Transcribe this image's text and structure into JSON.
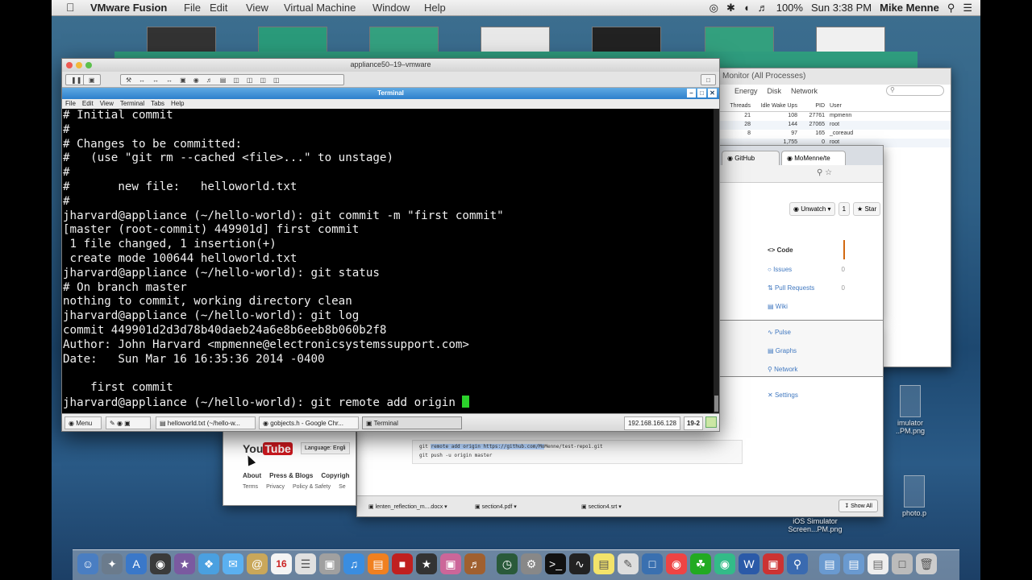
{
  "menubar": {
    "apple_icon": "apple-icon",
    "app_name": "VMware Fusion",
    "items": [
      "File",
      "Edit",
      "View",
      "Virtual Machine",
      "Window",
      "Help"
    ],
    "battery": "100%",
    "clock": "Sun 3:38 PM",
    "user": "Mike Menne"
  },
  "activity_monitor": {
    "title": "Monitor (All Processes)",
    "tabs": [
      "Energy",
      "Disk",
      "Network"
    ],
    "columns": [
      "Threads",
      "Idle Wake Ups",
      "PID",
      "User"
    ],
    "rows": [
      [
        "21",
        "108",
        "27761",
        "mpmenn"
      ],
      [
        "28",
        "144",
        "27065",
        "root"
      ],
      [
        "8",
        "97",
        "165",
        "_coreaud"
      ],
      [
        "",
        "1,755",
        "0",
        "root"
      ]
    ]
  },
  "github_window": {
    "tabs": [
      "GitHub",
      "MoMenne/te"
    ],
    "unwatch_label": "Unwatch",
    "unwatch_count": "1",
    "star_label": "Star",
    "star_count": "0",
    "nav": [
      "Code",
      "Issues",
      "Pull Requests",
      "Wiki",
      "Pulse",
      "Graphs",
      "Network",
      "Settings"
    ],
    "nav_counts": [
      "",
      "0",
      "0",
      "",
      "",
      "",
      "",
      ""
    ],
    "code_line1_prefix": "git ",
    "code_line1_highlight": "remote add origin https://github.com/Mo",
    "code_line1_suffix": "Menne/test-repo1.git",
    "code_line2": "git push -u origin master"
  },
  "downloads": {
    "items": [
      "lenten_reflection_m....docx",
      "section4.pdf",
      "section4.srt"
    ],
    "show_all": "Show All"
  },
  "youtube_window": {
    "logo_you": "You",
    "logo_tube": "Tube",
    "language": "Language: Engli",
    "links": [
      "About",
      "Press & Blogs",
      "Copyrigh"
    ],
    "links2": [
      "Terms",
      "Privacy",
      "Policy & Safety",
      "Se"
    ]
  },
  "desktop_icons": [
    {
      "label": "imulator\n..PM.png"
    },
    {
      "label": "iOS Simulator\nScreen...PM.png"
    },
    {
      "label": "photo.p"
    }
  ],
  "vmware": {
    "title": "appliance50–19–vmware"
  },
  "terminal": {
    "title": "Terminal",
    "menu": [
      "File",
      "Edit",
      "View",
      "Terminal",
      "Tabs",
      "Help"
    ],
    "lines": [
      "# Initial commit",
      "#",
      "# Changes to be committed:",
      "#   (use \"git rm --cached <file>...\" to unstage)",
      "#",
      "#       new file:   helloworld.txt",
      "#",
      "jharvard@appliance (~/hello-world): git commit -m \"first commit\"",
      "[master (root-commit) 449901d] first commit",
      " 1 file changed, 1 insertion(+)",
      " create mode 100644 helloworld.txt",
      "jharvard@appliance (~/hello-world): git status",
      "# On branch master",
      "nothing to commit, working directory clean",
      "jharvard@appliance (~/hello-world): git log",
      "commit 449901d2d3d78b40daeb24a6e8b6eeb8b060b2f8",
      "Author: John Harvard <mpmenne@electronicsystemssupport.com>",
      "Date:   Sun Mar 16 16:35:36 2014 -0400",
      "",
      "    first commit"
    ],
    "prompt": "jharvard@appliance (~/hello-world): git remote add origin "
  },
  "taskbar": {
    "menu_label": "Menu",
    "items": [
      "helloworld.txt (~/hello-w...",
      "gobjects.h - Google Chr...",
      "Terminal"
    ],
    "ip": "192.168.166.128",
    "workspace": "19-2"
  },
  "dock": {
    "calendar_date": "16"
  },
  "colors": {
    "terminal_bg": "#000000",
    "cursor": "#2bd22b",
    "terminal_title": "#2d7fcc"
  }
}
